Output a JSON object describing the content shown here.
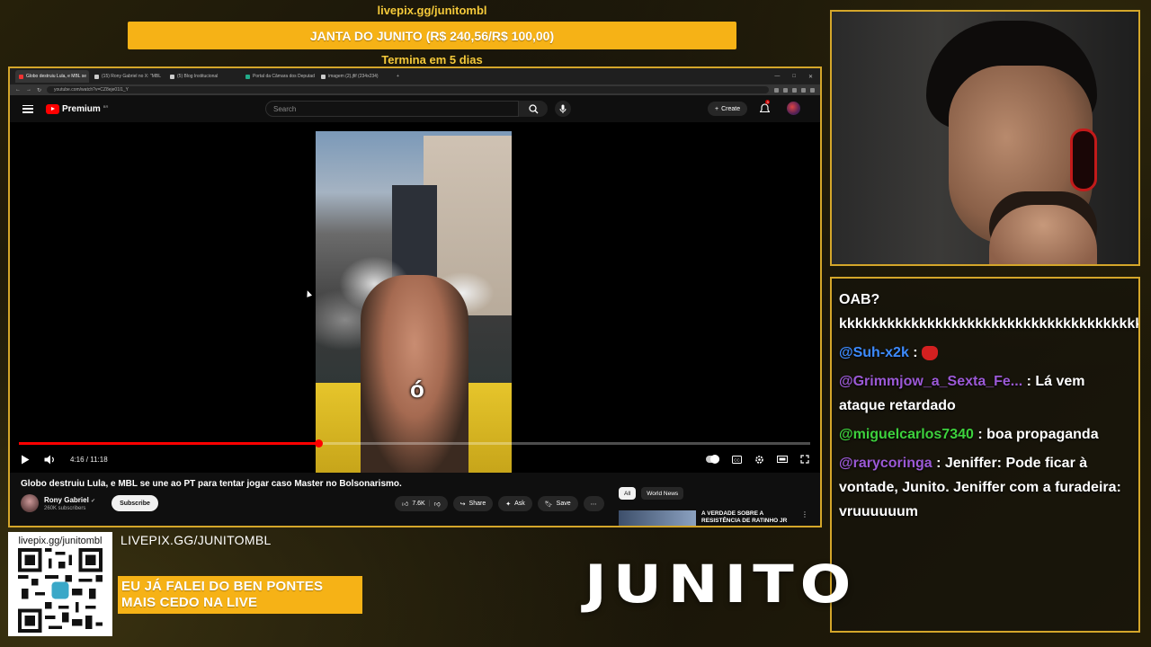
{
  "overlay": {
    "top_url": "livepix.gg/junitombl",
    "goal_text": "JANTA DO JUNITO (R$ 240,56/R$ 100,00)",
    "goal_ends": "Termina em 5 dias",
    "livepix_url": "LIVEPIX.GG/JUNITOMBL",
    "qr_label": "livepix.gg/junitombl",
    "ticker_line1": "EU JÁ FALEI DO BEN PONTES",
    "ticker_line2": "MAIS CEDO NA LIVE",
    "brand": "JUNITO",
    "accent_color": "#f6b216",
    "border_color": "#d4a62a"
  },
  "browser": {
    "tabs": [
      {
        "label": "Globo destruiu Lula, e MBL se",
        "icon": "youtube-icon",
        "active": true
      },
      {
        "label": "(15) Rony Gabriel no X: \"MBL",
        "icon": "x-icon",
        "active": false
      },
      {
        "label": "(5) Blog Institucional",
        "icon": "x-icon",
        "active": false
      },
      {
        "label": "Portal da Câmara dos Deputad",
        "icon": "camara-icon",
        "active": false
      },
      {
        "label": "imagem (2).jfif (234x234)",
        "icon": "image-icon",
        "active": false
      }
    ],
    "url": "youtube.com/watch?v=CZ8eje01l1_Y"
  },
  "youtube": {
    "logo_text": "Premium",
    "logo_region": "BR",
    "search_placeholder": "Search",
    "create_label": "Create",
    "notification_count": "3",
    "player": {
      "caption": "ó",
      "time": "4:16 / 11:18",
      "progress_fraction": 0.378
    },
    "video_title": "Globo destruiu Lula, e MBL se une ao PT para tentar jogar caso Master no Bolsonarismo.",
    "channel_name": "Rony Gabriel",
    "subscribers": "260K subscribers",
    "subscribe_label": "Subscribe",
    "likes": "7.6K",
    "share_label": "Share",
    "ask_label": "Ask",
    "save_label": "Save",
    "chips": [
      "All",
      "World News"
    ],
    "recommended_title": "A VERDADE SOBRE A RESISTÊNCIA DE RATINHO JR"
  },
  "chat": {
    "messages": [
      {
        "user": "",
        "user_color": "#ffffff",
        "text": "OAB? kkkkkkkkkkkkkkkkkkkkkkkkkkkkkkkkkkkkkkkkkkkkkkkkkkkkkkkkk"
      },
      {
        "user": "@Suh-x2k",
        "user_color": "#3d8bff",
        "text": "",
        "emoji": "red-creature-emoji"
      },
      {
        "user": "@Grimmjow_a_Sexta_Fe...",
        "user_color": "#9b59d6",
        "text": "Lá vem ataque retardado"
      },
      {
        "user": "@miguelcarlos7340",
        "user_color": "#3dd13d",
        "text": "boa propaganda"
      },
      {
        "user": "@rarycoringa",
        "user_color": "#9b59d6",
        "text": "Jeniffer: Pode ficar à vontade, Junito. Jeniffer com a furadeira: vruuuuuum"
      }
    ]
  }
}
